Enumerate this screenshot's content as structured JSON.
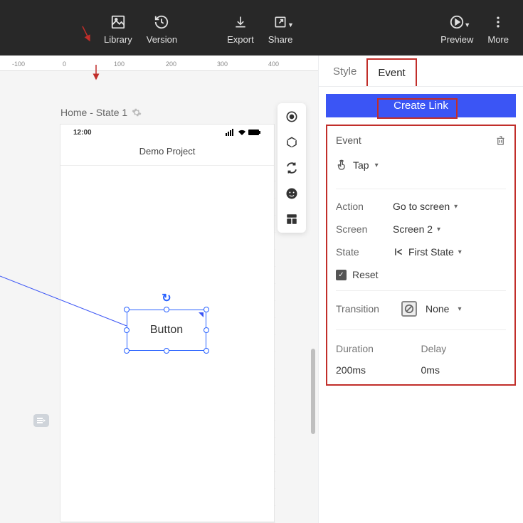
{
  "toolbar": {
    "library": "Library",
    "version": "Version",
    "export": "Export",
    "share": "Share",
    "preview": "Preview",
    "more": "More"
  },
  "ruler": {
    "m100": "-100",
    "p0": "0",
    "p100": "100",
    "p200": "200",
    "p300": "300",
    "p400": "400"
  },
  "canvas": {
    "breadcrumb": "Home - State 1",
    "status_time": "12:00",
    "project_title": "Demo Project",
    "selected_label": "Button"
  },
  "inspector": {
    "tabs": {
      "style": "Style",
      "event": "Event"
    },
    "create_link": "Create Link",
    "event_section_title": "Event",
    "trigger": "Tap",
    "action_label": "Action",
    "action_value": "Go to screen",
    "screen_label": "Screen",
    "screen_value": "Screen 2",
    "state_label": "State",
    "state_value": "First State",
    "reset_label": "Reset",
    "transition_label": "Transition",
    "transition_value": "None",
    "duration_label": "Duration",
    "duration_value": "200ms",
    "delay_label": "Delay",
    "delay_value": "0ms"
  }
}
